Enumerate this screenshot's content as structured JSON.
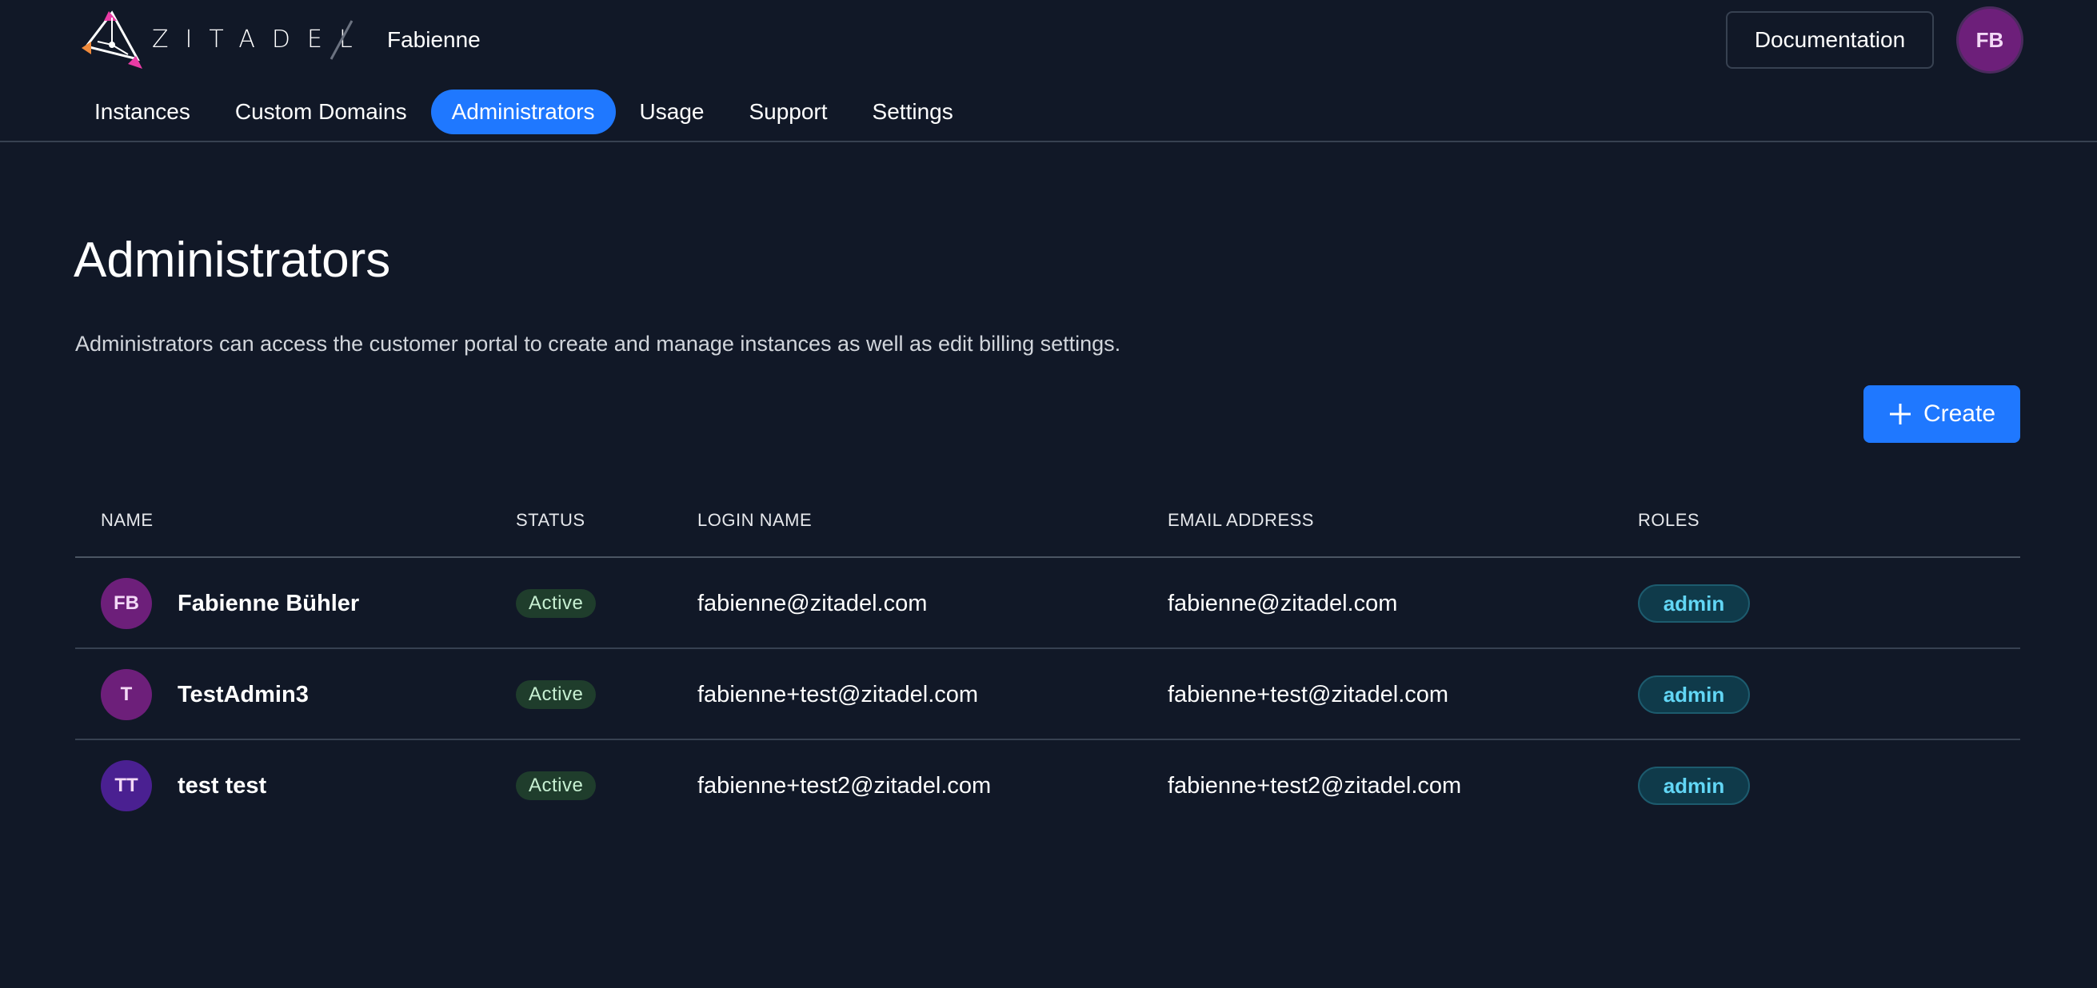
{
  "header": {
    "brand": "ZITADEL",
    "org_name": "Fabienne",
    "documentation_label": "Documentation",
    "user_initials": "FB"
  },
  "nav": {
    "tabs": [
      {
        "label": "Instances",
        "active": false
      },
      {
        "label": "Custom Domains",
        "active": false
      },
      {
        "label": "Administrators",
        "active": true
      },
      {
        "label": "Usage",
        "active": false
      },
      {
        "label": "Support",
        "active": false
      },
      {
        "label": "Settings",
        "active": false
      }
    ]
  },
  "main": {
    "title": "Administrators",
    "description": "Administrators can access the customer portal to create and manage instances as well as edit billing settings.",
    "create_label": "Create",
    "create_icon": "plus-icon"
  },
  "table": {
    "columns": [
      "NAME",
      "STATUS",
      "LOGIN NAME",
      "EMAIL ADDRESS",
      "ROLES"
    ],
    "rows": [
      {
        "initials": "FB",
        "avatar_color": "#6d1f7a",
        "name": "Fabienne Bühler",
        "status": "Active",
        "login_name": "fabienne@zitadel.com",
        "email": "fabienne@zitadel.com",
        "role": "admin"
      },
      {
        "initials": "T",
        "avatar_color": "#6d1f7a",
        "name": "TestAdmin3",
        "status": "Active",
        "login_name": "fabienne+test@zitadel.com",
        "email": "fabienne+test@zitadel.com",
        "role": "admin"
      },
      {
        "initials": "TT",
        "avatar_color": "#4a2091",
        "name": "test test",
        "status": "Active",
        "login_name": "fabienne+test2@zitadel.com",
        "email": "fabienne+test2@zitadel.com",
        "role": "admin"
      }
    ]
  },
  "colors": {
    "background": "#111827",
    "accent": "#1f78ff",
    "status_bg": "#1f3d2c",
    "role_text": "#62d6f5"
  }
}
